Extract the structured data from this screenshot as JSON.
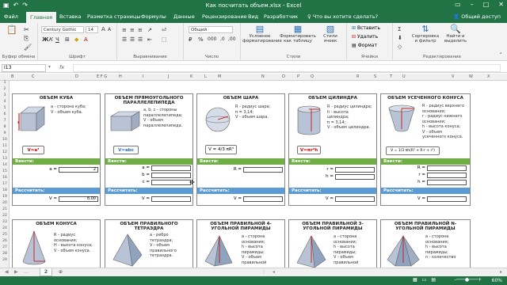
{
  "app": {
    "title": "Как посчитать объем.xlsx - Excel",
    "share": "Общий доступ",
    "tell_me": "Что вы хотите сделать?"
  },
  "tabs": [
    {
      "label": "Файл"
    },
    {
      "label": "Главная"
    },
    {
      "label": "Вставка"
    },
    {
      "label": "Разметка страницы"
    },
    {
      "label": "Формулы"
    },
    {
      "label": "Данные"
    },
    {
      "label": "Рецензирование"
    },
    {
      "label": "Вид"
    },
    {
      "label": "Разработчик"
    }
  ],
  "ribbon": {
    "clipboard": "Буфер обмена",
    "font": "Шрифт",
    "alignment": "Выравнивание",
    "number": "Число",
    "styles": "Стили",
    "cells": "Ячейки",
    "editing": "Редактирование",
    "font_name": "Century Gothic",
    "font_size": "14",
    "number_format": "Общий",
    "cond_format": "Условное форматирование",
    "format_table": "Форматировать как таблицу",
    "cell_styles": "Стили ячеек",
    "insert": "Вставить",
    "delete": "Удалить",
    "format": "Формат",
    "sort": "Сортировка и фильтр",
    "find": "Найти и выделить"
  },
  "formula_bar": {
    "name_box": "I13",
    "fx": "fx",
    "value": ""
  },
  "sheet_tab": "2",
  "zoom": "60%",
  "labels": {
    "vvesti": "Ввести:",
    "rasschitat": "Рассчитать:"
  },
  "cards": [
    {
      "title": "ОБЪЕМ КУБА",
      "desc": [
        "а - сторона куба;",
        "V - объем куба."
      ],
      "formula": "V=a³",
      "inputs": [
        {
          "label": "a =",
          "value": "2"
        }
      ],
      "result": {
        "label": "V =",
        "value": "8,00"
      }
    },
    {
      "title": "ОБЪЕМ ПРЯМОУГОЛЬНОГО ПАРАЛЛЕЛЕПИПЕДА",
      "desc": [
        "а, b, c - стороны",
        "параллелепипеда;",
        "V - объем",
        "параллелепипеда."
      ],
      "formula": "V=abc",
      "inputs": [
        {
          "label": "a =",
          "value": ""
        },
        {
          "label": "b =",
          "value": ""
        },
        {
          "label": "c =",
          "value": ""
        }
      ],
      "result": {
        "label": "V =",
        "value": ""
      }
    },
    {
      "title": "ОБЪЕМ ШАРА",
      "desc": [
        "R - радиус шара;",
        "π = 3,14;",
        "V - объем шара."
      ],
      "formula": "V = 4/3 πR³",
      "inputs": [
        {
          "label": "R =",
          "value": ""
        }
      ],
      "result": {
        "label": "V =",
        "value": ""
      }
    },
    {
      "title": "ОБЪЕМ ЦИЛИНДРА",
      "desc": [
        "R - радиус цилиндра;",
        "h - высота",
        "цилиндра;",
        "π = 3,14;",
        "V - объем цилиндра."
      ],
      "formula": "V=πr²h",
      "inputs": [
        {
          "label": "r =",
          "value": ""
        },
        {
          "label": "h =",
          "value": ""
        }
      ],
      "result": {
        "label": "V =",
        "value": ""
      }
    },
    {
      "title": "ОБЪЕМ УСЕЧЕННОГО КОНУСА",
      "desc": [
        "R - радиус верхнего",
        "основания;",
        "r - радиус нижнего",
        "основания;",
        "h - высота конуса;",
        "V - объем",
        "усеченного конуса."
      ],
      "formula": "V = 1/3 πh(R² + R·r + r²)",
      "inputs": [
        {
          "label": "R =",
          "value": ""
        },
        {
          "label": "r =",
          "value": ""
        },
        {
          "label": "h =",
          "value": ""
        }
      ],
      "result": {
        "label": "V =",
        "value": ""
      }
    },
    {
      "title": "ОБЪЕМ КОНУСА",
      "desc": [
        "R - радиус",
        "основания;",
        "H - высота конуса;",
        "V - объем конуса."
      ]
    },
    {
      "title": "ОБЪЕМ ПРАВИЛЬНОГО ТЕТРАЭДРА",
      "desc": [
        "а - ребро",
        "тетраэдра;",
        "V - объем",
        "правильного",
        "тетраэдра."
      ]
    },
    {
      "title": "ОБЪЕМ ПРАВИЛЬНОЙ 4-УГОЛЬНОЙ ПИРАМИДЫ",
      "desc": [
        "а - сторона",
        "основания;",
        "h - высота",
        "пирамиды;",
        "V - объем",
        "правильной"
      ]
    },
    {
      "title": "ОБЪЕМ ПРАВИЛЬНОЙ 3-УГОЛЬНОЙ ПИРАМИДЫ",
      "desc": [
        "а - сторона",
        "основания;",
        "h - высота",
        "пирамиды;",
        "V - объем",
        "правильной"
      ]
    },
    {
      "title": "ОБЪЕМ ПРАВИЛЬНОЙ N-УГОЛЬНОЙ ПИРАМИДЫ",
      "desc": [
        "а - сторона",
        "основания;",
        "h - высота",
        "пирамиды;",
        "n - количество"
      ]
    }
  ],
  "col_headers": [
    "B",
    "C",
    "D",
    "E F G",
    "H",
    "I",
    "J",
    "K",
    "L",
    "M",
    "N",
    "O",
    "P",
    "Q",
    "R",
    "S",
    "T",
    "U",
    "V",
    "W",
    "X"
  ],
  "row_headers": [
    "1",
    "2",
    "3",
    "4",
    "5",
    "6",
    "7",
    "8",
    "9",
    "10",
    "11",
    "12",
    "13",
    "14",
    "15",
    "16",
    "17",
    "18",
    "19",
    "20",
    "21",
    "22",
    "23",
    "24",
    "25",
    "26",
    "27",
    "28",
    "29"
  ],
  "colors": {
    "excel_green": "#217346",
    "input_green": "#70ad47",
    "calc_blue": "#5b9bd5"
  }
}
